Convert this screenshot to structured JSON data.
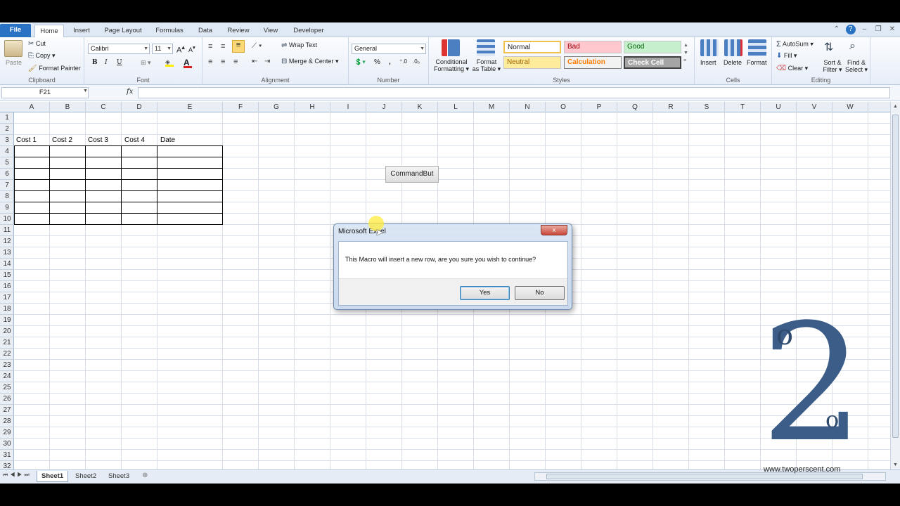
{
  "ribbon_tabs": [
    "File",
    "Home",
    "Insert",
    "Page Layout",
    "Formulas",
    "Data",
    "Review",
    "View",
    "Developer"
  ],
  "clipboard": {
    "paste": "Paste",
    "cut": "Cut",
    "copy": "Copy",
    "format_painter": "Format Painter",
    "label": "Clipboard"
  },
  "font": {
    "name": "Calibri",
    "size": "11",
    "bold": "B",
    "italic": "I",
    "underline": "U",
    "label": "Font"
  },
  "alignment": {
    "wrap_text": "Wrap Text",
    "merge_center": "Merge & Center",
    "label": "Alignment"
  },
  "number": {
    "format": "General",
    "percent": "%",
    "comma": ",",
    "label": "Number"
  },
  "styles": {
    "conditional": "Conditional",
    "formatting": "Formatting",
    "format_as": "Format",
    "as_table": "as Table",
    "normal": "Normal",
    "bad": "Bad",
    "good": "Good",
    "neutral": "Neutral",
    "calculation": "Calculation",
    "check_cell": "Check Cell",
    "label": "Styles"
  },
  "cells": {
    "insert": "Insert",
    "delete": "Delete",
    "format": "Format",
    "label": "Cells"
  },
  "editing": {
    "autosum": "AutoSum",
    "fill": "Fill",
    "clear": "Clear",
    "sort": "Sort &",
    "filter": "Filter",
    "find": "Find &",
    "select": "Select",
    "label": "Editing"
  },
  "formula_bar": {
    "name_box": "F21",
    "fx": "fx",
    "formula": ""
  },
  "columns": [
    "A",
    "B",
    "C",
    "D",
    "E",
    "F",
    "G",
    "H",
    "I",
    "J",
    "K",
    "L",
    "M",
    "N",
    "O",
    "P",
    "Q",
    "R",
    "S",
    "T",
    "U",
    "V",
    "W"
  ],
  "rows": [
    "1",
    "2",
    "3",
    "4",
    "5",
    "6",
    "7",
    "8",
    "9",
    "10",
    "11",
    "12",
    "13",
    "14",
    "15",
    "16",
    "17",
    "18",
    "19",
    "20",
    "21",
    "22",
    "23",
    "24",
    "25",
    "26",
    "27",
    "28",
    "29",
    "30",
    "31",
    "32"
  ],
  "cells_data": {
    "a3": "Cost 1",
    "b3": "Cost 2",
    "c3": "Cost 3",
    "d3": "Cost 4",
    "e3": "Date"
  },
  "command_button": "CommandBut",
  "dialog": {
    "title": "Microsoft Excel",
    "message": "This Macro will insert a new row, are you sure you wish to continue?",
    "yes": "Yes",
    "no": "No",
    "close": "x"
  },
  "sheets": [
    "Sheet1",
    "Sheet2",
    "Sheet3"
  ],
  "watermark": {
    "url": "www.twoperscent.com",
    "digit": "2",
    "ring1": "o",
    "ring2": "o"
  },
  "colors": {
    "accent": "#2a73c4",
    "logo": "#3c5d88"
  }
}
